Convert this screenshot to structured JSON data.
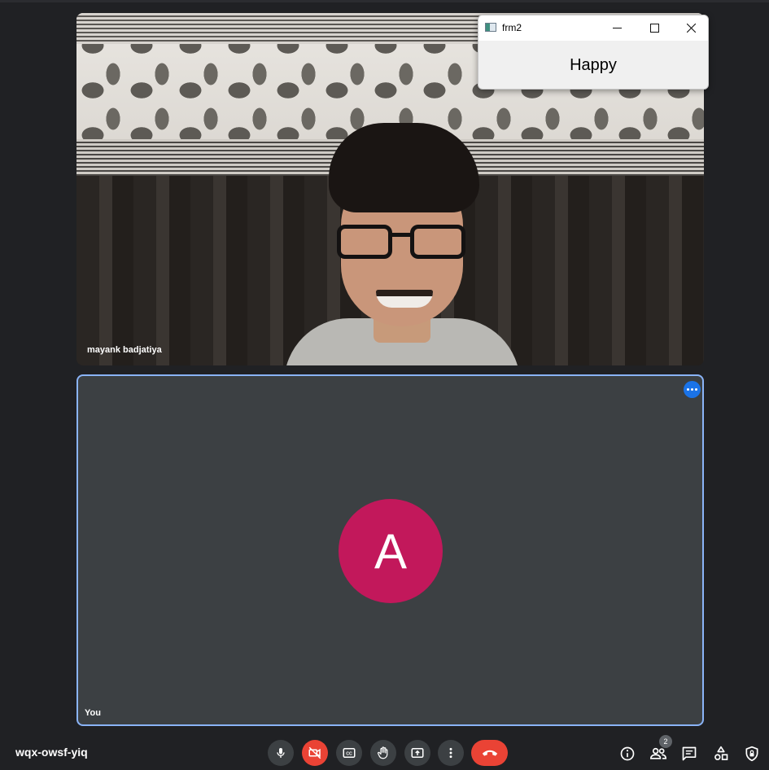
{
  "window": {
    "title": "frm2",
    "label": "Happy"
  },
  "participants": {
    "remote_name": "mayank badjatiya",
    "self_name": "You",
    "self_avatar_initial": "A"
  },
  "meeting": {
    "code": "wqx-owsf-yiq",
    "participant_count": "2"
  },
  "controls": {
    "icons": [
      "mic-icon",
      "camera-off-icon",
      "captions-icon",
      "raise-hand-icon",
      "present-icon",
      "more-options-icon",
      "hang-up-icon"
    ]
  },
  "right_icons": [
    "info-icon",
    "people-icon",
    "chat-icon",
    "activities-icon",
    "host-controls-icon"
  ],
  "colors": {
    "background": "#202124",
    "tile": "#3c4043",
    "accent_border": "#8ab4f8",
    "avatar": "#c2185b",
    "danger": "#ea4335",
    "menu_blue": "#1a73e8"
  }
}
